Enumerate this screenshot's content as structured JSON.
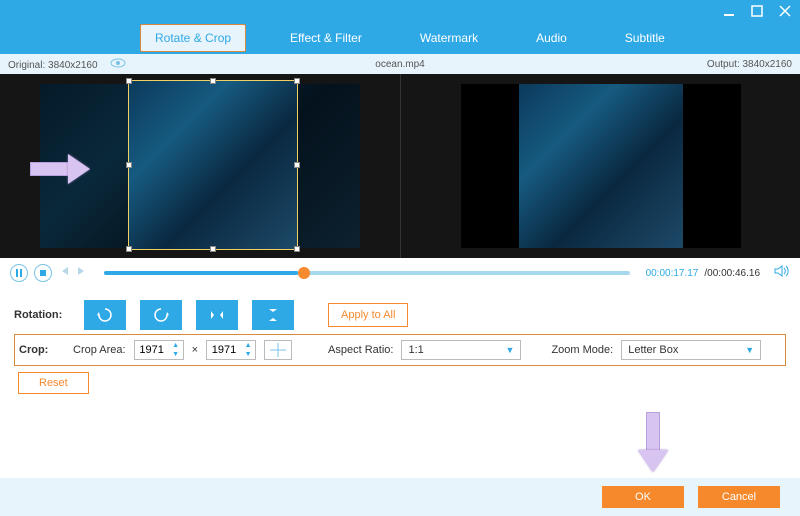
{
  "window": {
    "title": ""
  },
  "tabs": {
    "rotate_crop": "Rotate & Crop",
    "effect_filter": "Effect & Filter",
    "watermark": "Watermark",
    "audio": "Audio",
    "subtitle": "Subtitle"
  },
  "info": {
    "original_label": "Original: 3840x2160",
    "filename": "ocean.mp4",
    "output_label": "Output: 3840x2160"
  },
  "playback": {
    "current": "00:00:17.17",
    "sep": "/",
    "total": "00:00:46.16"
  },
  "rotation": {
    "label": "Rotation:",
    "apply_to_all": "Apply to All"
  },
  "crop": {
    "label": "Crop:",
    "crop_area_label": "Crop Area:",
    "width": "1971",
    "height": "1971",
    "mult": "×",
    "aspect_label": "Aspect Ratio:",
    "aspect_value": "1:1",
    "zoom_label": "Zoom Mode:",
    "zoom_value": "Letter Box",
    "reset": "Reset"
  },
  "footer": {
    "ok": "OK",
    "cancel": "Cancel"
  },
  "icons": {
    "rotate_ccw": "rotate-ccw",
    "rotate_cw": "rotate-cw",
    "flip_h": "flip-horizontal",
    "flip_v": "flip-vertical"
  }
}
